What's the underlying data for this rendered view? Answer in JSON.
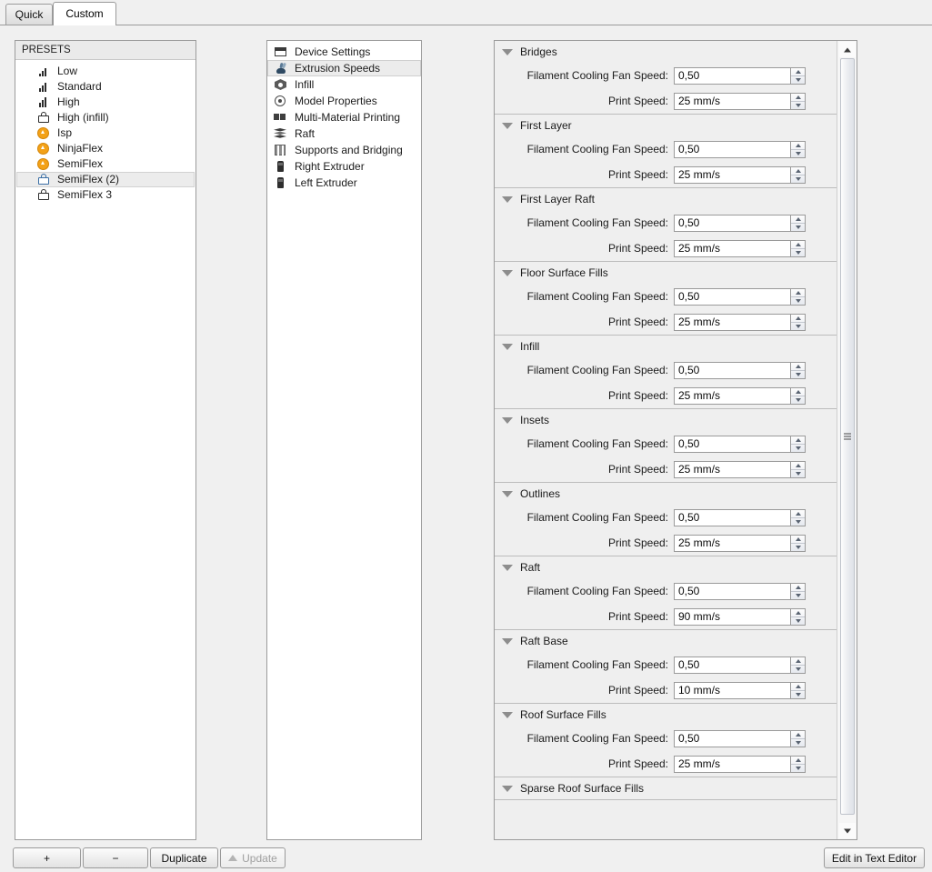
{
  "tabs": [
    {
      "label": "Quick",
      "active": false
    },
    {
      "label": "Custom",
      "active": true
    }
  ],
  "presets": {
    "header": "PRESETS",
    "items": [
      {
        "label": "Low",
        "icon": "quality-bars-icon",
        "selected": false
      },
      {
        "label": "Standard",
        "icon": "quality-bars-icon",
        "selected": false
      },
      {
        "label": "High",
        "icon": "quality-bars-icon",
        "selected": false
      },
      {
        "label": "High (infill)",
        "icon": "lock-icon",
        "selected": false
      },
      {
        "label": "Isp",
        "icon": "flex-material-icon",
        "selected": false
      },
      {
        "label": "NinjaFlex",
        "icon": "flex-material-icon",
        "selected": false
      },
      {
        "label": "SemiFlex",
        "icon": "flex-material-icon",
        "selected": false
      },
      {
        "label": "SemiFlex (2)",
        "icon": "lock-icon",
        "selected": true
      },
      {
        "label": "SemiFlex 3",
        "icon": "lock-icon",
        "selected": false
      }
    ]
  },
  "categories": {
    "items": [
      {
        "label": "Device Settings",
        "icon": "window-icon",
        "selected": false
      },
      {
        "label": "Extrusion Speeds",
        "icon": "rabbit-icon",
        "selected": true
      },
      {
        "label": "Infill",
        "icon": "infill-cube-icon",
        "selected": false
      },
      {
        "label": "Model Properties",
        "icon": "target-icon",
        "selected": false
      },
      {
        "label": "Multi-Material Printing",
        "icon": "multi-material-icon",
        "selected": false
      },
      {
        "label": "Raft",
        "icon": "layers-icon",
        "selected": false
      },
      {
        "label": "Supports and Bridging",
        "icon": "support-box-icon",
        "selected": false
      },
      {
        "label": "Right Extruder",
        "icon": "extruder-icon",
        "selected": false
      },
      {
        "label": "Left Extruder",
        "icon": "extruder-icon",
        "selected": false
      }
    ]
  },
  "settings": {
    "labels": {
      "fan_speed": "Filament Cooling Fan Speed:",
      "print_speed": "Print Speed:"
    },
    "sections": [
      {
        "title": "Bridges",
        "fan_speed": "0,50",
        "print_speed": "25 mm/s",
        "collapsed": false
      },
      {
        "title": "First Layer",
        "fan_speed": "0,50",
        "print_speed": "25 mm/s",
        "collapsed": false
      },
      {
        "title": "First Layer Raft",
        "fan_speed": "0,50",
        "print_speed": "25 mm/s",
        "collapsed": false
      },
      {
        "title": "Floor Surface Fills",
        "fan_speed": "0,50",
        "print_speed": "25 mm/s",
        "collapsed": false
      },
      {
        "title": "Infill",
        "fan_speed": "0,50",
        "print_speed": "25 mm/s",
        "collapsed": false
      },
      {
        "title": "Insets",
        "fan_speed": "0,50",
        "print_speed": "25 mm/s",
        "collapsed": false
      },
      {
        "title": "Outlines",
        "fan_speed": "0,50",
        "print_speed": "25 mm/s",
        "collapsed": false
      },
      {
        "title": "Raft",
        "fan_speed": "0,50",
        "print_speed": "90 mm/s",
        "collapsed": false
      },
      {
        "title": "Raft Base",
        "fan_speed": "0,50",
        "print_speed": "10 mm/s",
        "collapsed": false
      },
      {
        "title": "Roof Surface Fills",
        "fan_speed": "0,50",
        "print_speed": "25 mm/s",
        "collapsed": false
      },
      {
        "title": "Sparse Roof Surface Fills",
        "fan_speed": "",
        "print_speed": "",
        "collapsed": false
      }
    ]
  },
  "buttons": {
    "add": "+",
    "remove": "−",
    "duplicate": "Duplicate",
    "update": "Update",
    "edit_in_text_editor": "Edit in Text Editor"
  },
  "colors": {
    "accent_orange": "#f3a117",
    "panel_bg": "#efefef",
    "window_bg": "#f0f0f0",
    "border": "#9b9b9b",
    "selection": "#ececec"
  }
}
